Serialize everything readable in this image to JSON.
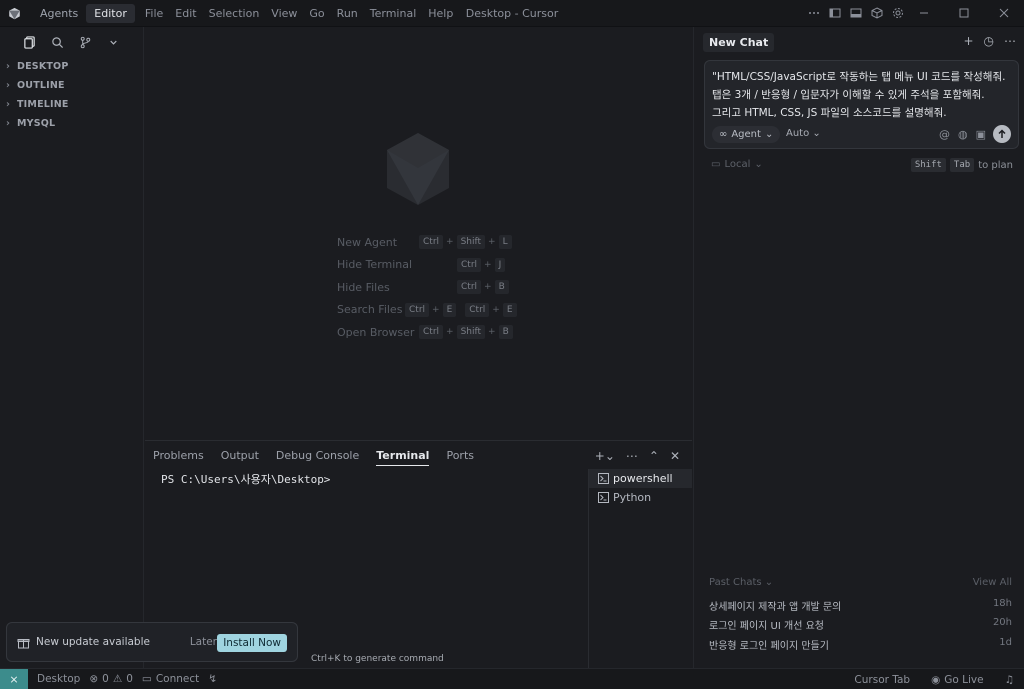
{
  "titlebar": {
    "segments": [
      "Agents",
      "Editor"
    ],
    "active_segment": "Editor",
    "menu": [
      "File",
      "Edit",
      "Selection",
      "View",
      "Go",
      "Run",
      "Terminal",
      "Help"
    ],
    "window_title": "Desktop - Cursor"
  },
  "sidebar": {
    "sections": [
      "DESKTOP",
      "OUTLINE",
      "TIMELINE",
      "MYSQL"
    ]
  },
  "editor": {
    "shortcuts": [
      {
        "label": "New Agent",
        "keys": [
          "Ctrl",
          "Shift",
          "L"
        ]
      },
      {
        "label": "Hide Terminal",
        "keys": [
          "Ctrl",
          "J"
        ]
      },
      {
        "label": "Hide Files",
        "keys": [
          "Ctrl",
          "B"
        ]
      },
      {
        "label": "Search Files",
        "keys": [
          "Ctrl",
          "E"
        ],
        "keys2": [
          "Ctrl",
          "E"
        ]
      },
      {
        "label": "Open Browser",
        "keys": [
          "Ctrl",
          "Shift",
          "B"
        ]
      }
    ]
  },
  "panel": {
    "tabs": [
      "Problems",
      "Output",
      "Debug Console",
      "Terminal",
      "Ports"
    ],
    "active_tab": "Terminal",
    "prompt": "PS C:\\Users\\사용자\\Desktop>",
    "terminals": [
      "powershell",
      "Python"
    ],
    "hint": "Ctrl+K to generate command"
  },
  "chat": {
    "tab_label": "New Chat",
    "prompt_lines": [
      "\"HTML/CSS/JavaScript로 작동하는 탭 메뉴 UI 코드를 작성해줘.",
      "탭은 3개 / 반응형 / 입문자가 이해할 수 있게 주석을 포함해줘.",
      "그리고 HTML, CSS, JS 파일의 소스코드를 설명해줘."
    ],
    "mode": "Agent",
    "model": "Auto",
    "location": "Local",
    "plan_keys": [
      "Shift",
      "Tab"
    ],
    "plan_text": "to plan",
    "past_header": "Past Chats",
    "view_all": "View All",
    "past_chats": [
      {
        "title": "상세페이지 제작과 앱 개발 문의",
        "age": "18h"
      },
      {
        "title": "로그인 페이지 UI 개선 요청",
        "age": "20h"
      },
      {
        "title": "반응형 로그인 페이지 만들기",
        "age": "1d"
      }
    ]
  },
  "toast": {
    "text": "New update available",
    "later": "Later",
    "install": "Install Now"
  },
  "statusbar": {
    "folder": "Desktop",
    "errors": "0",
    "warnings": "0",
    "connect": "Connect",
    "cursor_tab": "Cursor Tab",
    "go_live": "Go Live"
  }
}
